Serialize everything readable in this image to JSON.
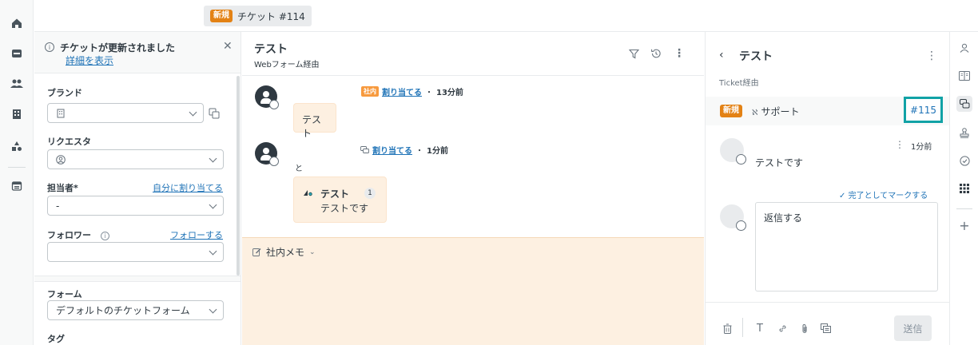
{
  "header": {
    "tab_badge": "新規",
    "tab_title": "チケット #114"
  },
  "notice": {
    "title": "チケットが更新されました",
    "link": "詳細を表示"
  },
  "properties": {
    "brand_label": "ブランド",
    "requester_label": "リクエスタ",
    "assignee_label": "担当者*",
    "assign_self_link": "自分に割り当てる",
    "assignee_value": "-",
    "followers_label": "フォロワー",
    "follow_link": "フォローする",
    "form_label": "フォーム",
    "form_value": "デフォルトのチケットフォーム",
    "tags_label": "タグ"
  },
  "conversation": {
    "title": "テスト",
    "subtitle": "Webフォーム経由",
    "events": [
      {
        "badge": "社内",
        "action": "割り当てる",
        "time": "13分前",
        "bubble": "テスト"
      },
      {
        "action": "割り当てる",
        "time": "1分前",
        "to_label": "と",
        "card_title": "テスト",
        "card_count": "1",
        "card_body": "テストです"
      }
    ],
    "memo_label": "社内メモ"
  },
  "context": {
    "title": "テスト",
    "subtitle": "Ticket経由",
    "status_badge": "新規",
    "group": "サポート",
    "ticket_id": "#115",
    "comment_time": "1分前",
    "comment_text": "テストです",
    "mark_complete": "完了としてマークする",
    "reply_placeholder": "返信する",
    "send_label": "送信"
  },
  "colors": {
    "new_badge": "#e38215",
    "internal_badge": "#f79a3e",
    "link": "#1f73b7",
    "highlight": "#11a2a6",
    "memo_bg": "#fdf0e1"
  }
}
